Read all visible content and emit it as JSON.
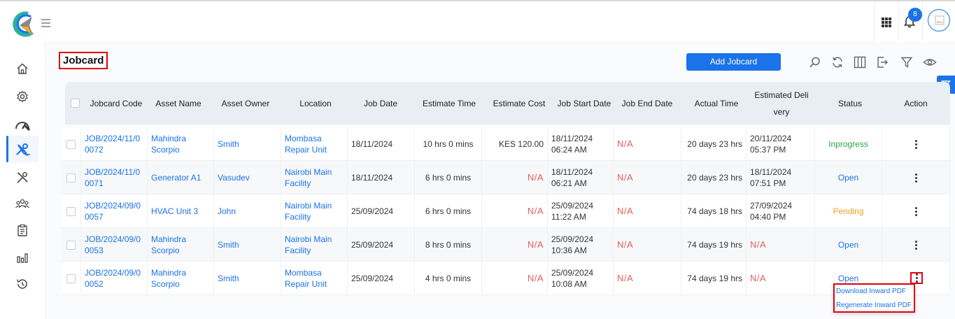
{
  "page": {
    "title": "Jobcard"
  },
  "header": {
    "notification_count": "8"
  },
  "toolbar": {
    "add_label": "Add Jobcard"
  },
  "columns": [
    "Jobcard Code",
    "Asset Name",
    "Asset Owner",
    "Location",
    "Job Date",
    "Estimate Time",
    "Estimate Cost",
    "Job Start Date",
    "Job End Date",
    "Actual Time",
    "Estimated Delivery",
    "Status",
    "Action"
  ],
  "rows": [
    {
      "code": "JOB/2024/11/00072",
      "asset": "Mahindra Scorpio",
      "owner": "Smith",
      "location": "Mombasa Repair Unit",
      "job_date": "18/11/2024",
      "est_time": "10 hrs 0 mins",
      "est_cost": "KES 120.00",
      "start": "18/11/2024 06:24 AM",
      "end": "N/A",
      "actual": "20 days 23 hrs",
      "delivery": "20/11/2024 05:37 PM",
      "status": "Inprogress"
    },
    {
      "code": "JOB/2024/11/00071",
      "asset": "Generator A1",
      "owner": "Vasudev",
      "location": "Nairobi Main Facility",
      "job_date": "18/11/2024",
      "est_time": "6 hrs 0 mins",
      "est_cost": "N/A",
      "start": "18/11/2024 06:21 AM",
      "end": "N/A",
      "actual": "20 days 23 hrs",
      "delivery": "18/11/2024 07:51 PM",
      "status": "Open"
    },
    {
      "code": "JOB/2024/09/00057",
      "asset": "HVAC Unit 3",
      "owner": "John",
      "location": "Nairobi Main Facility",
      "job_date": "25/09/2024",
      "est_time": "6 hrs 0 mins",
      "est_cost": "N/A",
      "start": "25/09/2024 11:22 AM",
      "end": "N/A",
      "actual": "74 days 18 hrs",
      "delivery": "27/09/2024 04:40 PM",
      "status": "Pending"
    },
    {
      "code": "JOB/2024/09/00053",
      "asset": "Mahindra Scorpio",
      "owner": "Smith",
      "location": "Nairobi Main Facility",
      "job_date": "25/09/2024",
      "est_time": "8 hrs 0 mins",
      "est_cost": "N/A",
      "start": "25/09/2024 10:36 AM",
      "end": "N/A",
      "actual": "74 days 19 hrs",
      "delivery": "N/A",
      "status": "Open"
    },
    {
      "code": "JOB/2024/09/00052",
      "asset": "Mahindra Scorpio",
      "owner": "Smith",
      "location": "Mombasa Repair Unit",
      "job_date": "25/09/2024",
      "est_time": "4 hrs 0 mins",
      "est_cost": "N/A",
      "start": "25/09/2024 10:08 AM",
      "end": "N/A",
      "actual": "74 days 19 hrs",
      "delivery": "N/A",
      "status": "Open"
    }
  ],
  "action_menu": {
    "items": [
      "Download Inward PDF",
      "Regenerate Inward PDF"
    ]
  },
  "colors": {
    "primary": "#1a73e8",
    "na": "#e35d5d",
    "inprogress": "#28a745",
    "pending": "#f0a020",
    "highlight": "#e3000f"
  }
}
